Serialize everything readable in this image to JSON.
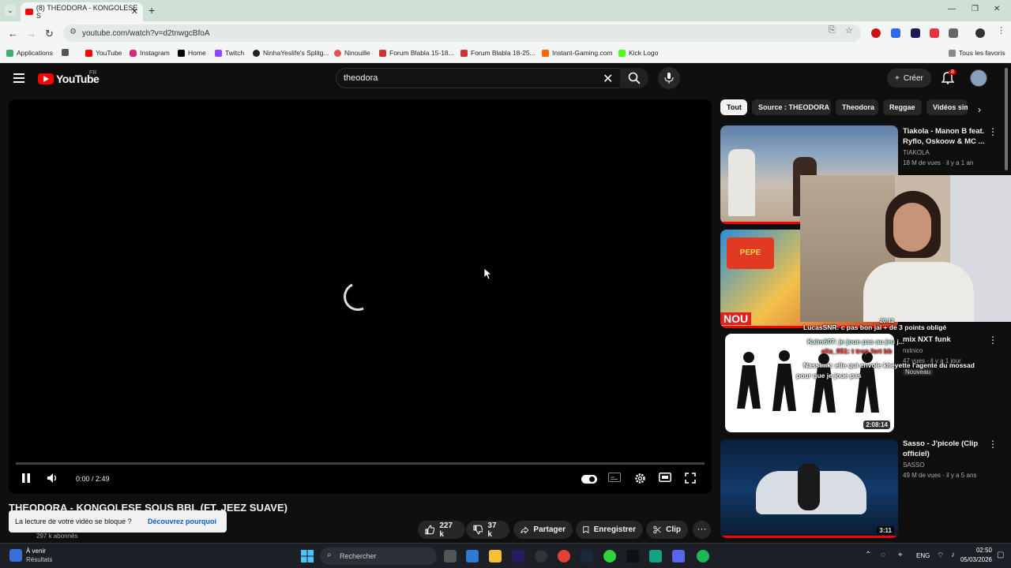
{
  "browser": {
    "tab_title": "(8) THEODORA - KONGOLESE S",
    "url": "youtube.com/watch?v=d2tnwgcBfoA",
    "bookmarks": [
      "Applications",
      "YouTube",
      "Instagram",
      "Home",
      "Twitch",
      "NinhaYeslife's Splitg...",
      "Ninouille",
      "Forum Blabla 15-18...",
      "Forum Blabla 18-25...",
      "Instant-Gaming.com",
      "Kick Logo"
    ],
    "all_favorites": "Tous les favoris"
  },
  "header": {
    "logo_text": "YouTube",
    "region": "FR",
    "search_value": "theodora",
    "create_label": "Créer",
    "notif_count": "8"
  },
  "player": {
    "time": "0:00 / 2:49",
    "progress": 0
  },
  "video": {
    "title": "THEODORA - KONGOLESE SOUS BBL (FT. JEEZ SUAVE)",
    "subscribers": "297 k abonnés",
    "toast_text": "La lecture de votre vidéo se bloque ?",
    "toast_link": "Découvrez pourquoi",
    "likes": "227 k",
    "dislikes": "37 k",
    "share": "Partager",
    "save": "Enregistrer",
    "clip": "Clip"
  },
  "chips": [
    "Tout",
    "Source : THEODORA",
    "Theodora",
    "Reggae",
    "Vidéos sim"
  ],
  "recommendations": [
    {
      "title": "Tiakola - Manon B feat. Ryflo, Oskoow & MC ...",
      "channel": "TIAKOLA",
      "meta": "18 M de vues · il y a 1 an"
    },
    {
      "title": "mix NXT funk",
      "channel": "nxtnico",
      "meta": "47 vues · il y a 1 jour",
      "badge": "Nouveau",
      "duration": "2:08:14"
    },
    {
      "title": "Sasso - J'picole (Clip officiel)",
      "channel": "SASSO",
      "meta": "49 M de vues · il y a 5 ans",
      "duration": "3:11"
    }
  ],
  "stream_overlay": {
    "chat": [
      "LucasSNR: c pas bon jai + de 3 points obligé",
      "Kalm607: je joue pas au jeu j...",
      "elia_951: t trop fort bb",
      "Nassimk: elle qui envoie kheyette l'agente du mossad",
      "pour que je joue pas"
    ],
    "duration_small": "20:12",
    "nou_text": "NOU"
  },
  "taskbar": {
    "weather_title": "À venir",
    "weather_sub": "Résultats",
    "search_placeholder": "Rechercher",
    "lang": "ENG",
    "time": "02:50",
    "date": "05/03/2026"
  }
}
